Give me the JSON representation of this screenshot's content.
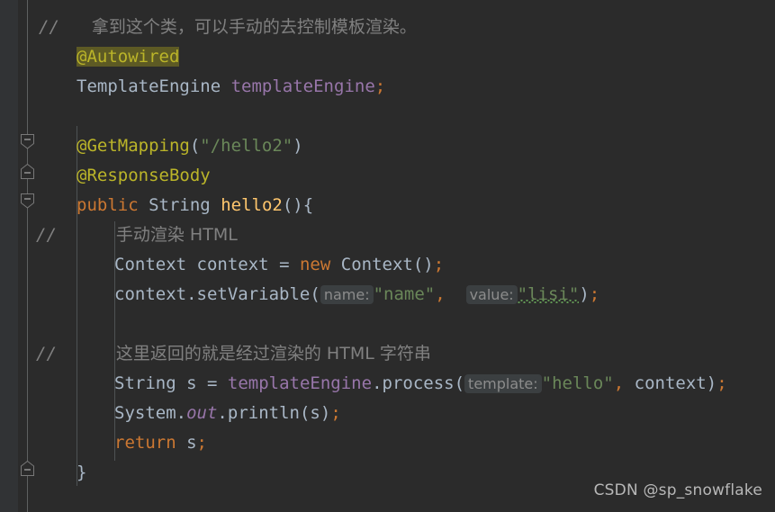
{
  "editor": {
    "theme": "darcula",
    "background": "#2b2b2b",
    "gutter_background": "#313335",
    "accent_annotation": "#bbb529",
    "accent_keyword": "#cc7832",
    "accent_string": "#6a8759",
    "accent_field": "#9876aa",
    "accent_method": "#ffc66d",
    "accent_comment": "#808080",
    "accent_text": "#a9b7c6",
    "highlight_background": "#5d5a24"
  },
  "code": {
    "line1": {
      "comment_slashes": "//",
      "comment_text": "拿到这个类，可以手动的去控制模板渲染。"
    },
    "line2": {
      "annotation": "@Autowired"
    },
    "line3": {
      "type": "TemplateEngine",
      "field": "templateEngine",
      "semicolon": ";"
    },
    "line5": {
      "annotation": "@GetMapping",
      "open_paren": "(",
      "string": "\"/hello2\"",
      "close_paren": ")"
    },
    "line6": {
      "annotation": "@ResponseBody"
    },
    "line7": {
      "keyword": "public",
      "type": "String",
      "method": "hello2",
      "parens": "()",
      "brace": "{"
    },
    "line8": {
      "comment_slashes": "//",
      "comment_text": "手动渲染 HTML"
    },
    "line9": {
      "type": "Context",
      "variable": "context",
      "equals": "=",
      "keyword": "new",
      "constructor": "Context",
      "parens": "()",
      "semicolon": ";"
    },
    "line10": {
      "variable": "context",
      "dot": ".",
      "method": "setVariable",
      "open_paren": "(",
      "hint1": "name:",
      "string1": "\"name\"",
      "comma": ",",
      "hint2": "value:",
      "string2": "\"lisi\"",
      "close_paren": ")",
      "semicolon": ";"
    },
    "line12": {
      "comment_slashes": "//",
      "comment_text": "这里返回的就是经过渲染的 HTML 字符串"
    },
    "line13": {
      "type": "String",
      "variable": "s",
      "equals": "=",
      "field": "templateEngine",
      "dot": ".",
      "method": "process",
      "open_paren": "(",
      "hint": "template:",
      "string": "\"hello\"",
      "comma": ",",
      "arg": "context",
      "close_paren": ")",
      "semicolon": ";"
    },
    "line14": {
      "class": "System",
      "dot1": ".",
      "static_field": "out",
      "dot2": ".",
      "method": "println",
      "open_paren": "(",
      "arg": "s",
      "close_paren": ")",
      "semicolon": ";"
    },
    "line15": {
      "keyword": "return",
      "variable": "s",
      "semicolon": ";"
    },
    "line16": {
      "brace": "}"
    }
  },
  "gutter": {
    "fold_markers": [
      {
        "label": "collapse-fold-getmapping",
        "type": "down"
      },
      {
        "label": "collapse-fold-responsebody",
        "type": "both"
      },
      {
        "label": "collapse-fold-method",
        "type": "down"
      },
      {
        "label": "collapse-fold-method-end",
        "type": "up"
      }
    ],
    "fold_glyph": "−"
  },
  "watermark": {
    "text": "CSDN @sp_snowflake"
  }
}
